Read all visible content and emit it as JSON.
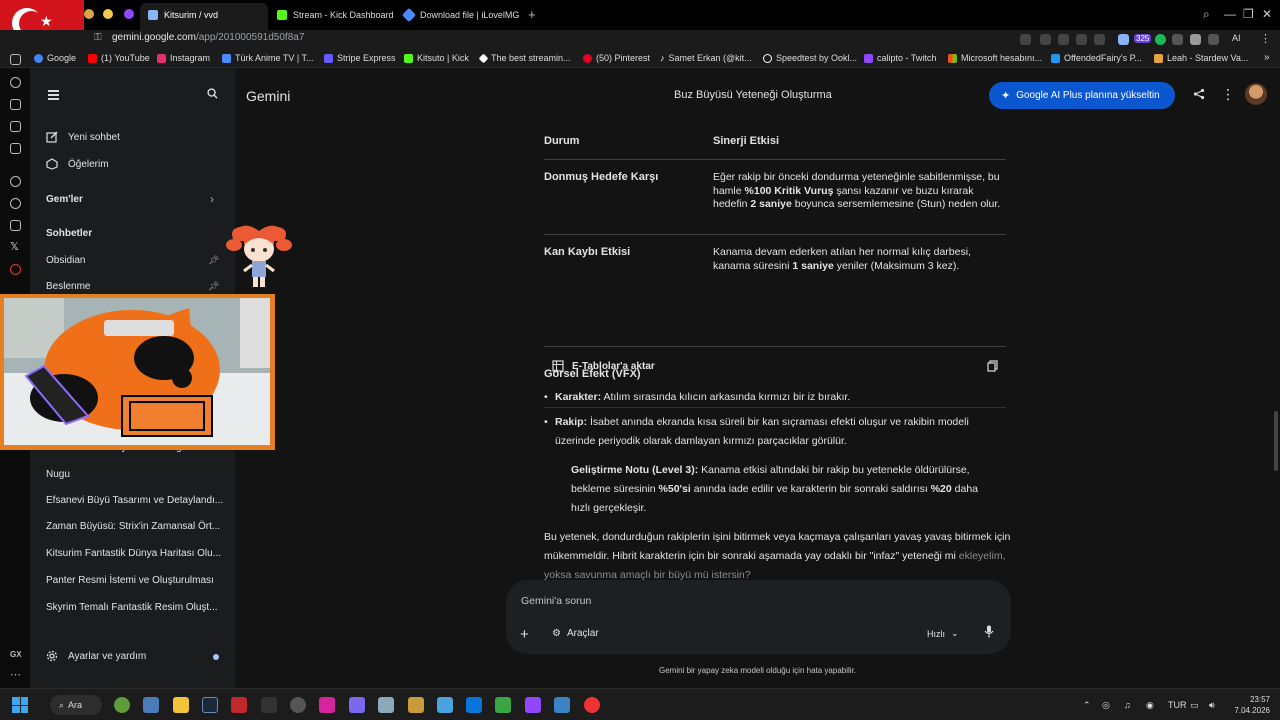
{
  "browser": {
    "tabs": [
      {
        "label": "Kitsurim / vvd"
      },
      {
        "label": "Stream - Kick Dashboard"
      },
      {
        "label": "Download file | iLovelMG"
      }
    ],
    "new_tab": "+",
    "url_host": "gemini.google.com",
    "url_path": "/app/201000591d50f8a7",
    "badge_count": "325",
    "ai_label": "AI",
    "bookmarks": [
      {
        "label": "Google",
        "color": "#4285f4"
      },
      {
        "label": "(1) YouTube",
        "color": "#ff0000"
      },
      {
        "label": "Instagram",
        "color": "#e1306c"
      },
      {
        "label": "Türk Anime TV | T...",
        "color": "#4a8cff"
      },
      {
        "label": "Stripe Express",
        "color": "#635bff"
      },
      {
        "label": "Kitsuto | Kick",
        "color": "#53fc18"
      },
      {
        "label": "The best streamin...",
        "color": "#ffffff"
      },
      {
        "label": "(50) Pinterest",
        "color": "#e60023"
      },
      {
        "label": "Samet Erkan (@kit...",
        "color": "#ffffff"
      },
      {
        "label": "Speedtest by Ookl...",
        "color": "#ffffff"
      },
      {
        "label": "calipto - Twitch",
        "color": "#9146ff"
      },
      {
        "label": "Microsoft hesabını...",
        "color": "#f25022"
      },
      {
        "label": "OffendedFairy's P...",
        "color": "#2196f3"
      },
      {
        "label": "Leah - Stardew Va...",
        "color": "#e8a33d"
      }
    ]
  },
  "sidebar": {
    "new_chat": "Yeni sohbet",
    "items_label": "Öğelerim",
    "gems": "Gem'ler",
    "chats_header": "Sohbetler",
    "chats": [
      {
        "label": "Obsidian",
        "pinned": true
      },
      {
        "label": "Beslenme",
        "pinned": true
      },
      {
        "label": "Fantastik Buz Büyüsü Yeteneği Tasarımı",
        "pinned": false
      },
      {
        "label": "Nugu",
        "pinned": false
      },
      {
        "label": "Efsanevi Büyü Tasarımı ve Detaylandı...",
        "pinned": false
      },
      {
        "label": "Zaman Büyüsü: Strix'in Zamansal Ört...",
        "pinned": false
      },
      {
        "label": "Kitsurim Fantastik Dünya Haritası Olu...",
        "pinned": false
      },
      {
        "label": "Panter Resmi İstemi ve Oluşturulması",
        "pinned": false
      },
      {
        "label": "Skyrim Temalı Fantastik Resim Oluşt...",
        "pinned": false
      }
    ],
    "settings": "Ayarlar ve yardım"
  },
  "header": {
    "app_name": "Gemini",
    "chat_title": "Buz Büyüsü Yeteneği Oluşturma",
    "upgrade": "Google AI Plus planına yükseltin"
  },
  "table": {
    "col1": "Durum",
    "col2": "Sinerji Etkisi",
    "rows": [
      {
        "state": "Donmuş Hedefe Karşı",
        "effect_html": "Eğer rakip bir önceki dondurma yeteneğinle sabitlenmişse, bu hamle <b>%100 Kritik Vuruş</b> şansı kazanır ve buzu kırarak hedefin <b>2 saniye</b> boyunca sersemlemesine (Stun) neden olur."
      },
      {
        "state": "Kan Kaybı Etkisi",
        "effect_html": "Kanama devam ederken atılan her normal kılıç darbesi, kanama süresini <b>1 saniye</b> yeniler (Maksimum 3 kez)."
      }
    ],
    "export": "E-Tablolar'a aktar"
  },
  "content": {
    "vfx_heading": "Görsel Efekt (VFX)",
    "bullet1_label": "Karakter:",
    "bullet1_text": " Atılım sırasında kılıcın arkasında kırmızı bir iz bırakır.",
    "bullet2_label": "Rakip:",
    "bullet2_text": " İsabet anında ekranda kısa süreli bir kan sıçraması efekti oluşur ve rakibin modeli üzerinde periyodik olarak damlayan kırmızı parçacıklar görülür.",
    "note_label": "Geliştirme Notu (Level 3):",
    "note_html": " Kanama etkisi altındaki bir rakip bu yetenekle öldürülürse, bekleme süresinin <b>%50'si</b> anında iade edilir ve karakterin bir sonraki saldırısı <b>%20</b> daha hızlı gerçekleşir.",
    "final_para": "Bu yetenek, dondurduğun rakiplerin işini bitirmek veya kaçmaya çalışanları yavaş yavaş bitirmek için mükemmeldir. Hibrit karakterin için bir sonraki aşamada yay odaklı bir \"infaz\" yeteneği mi",
    "final_para_fade": "ekleyelim, yoksa savunma amaçlı bir büyü mü istersin?"
  },
  "input": {
    "placeholder": "Gemini'a sorun",
    "tools": "Araçlar",
    "model": "Hızlı",
    "disclaimer": "Gemini bir yapay zeka modeli olduğu için hata yapabilir."
  },
  "taskbar": {
    "search": "Ara",
    "lang": "TUR",
    "time": "23:57",
    "date": "7.04.2026"
  },
  "colors": {
    "accent": "#0b57d0",
    "background": "#131314",
    "sidebar": "#1b1c1d"
  }
}
